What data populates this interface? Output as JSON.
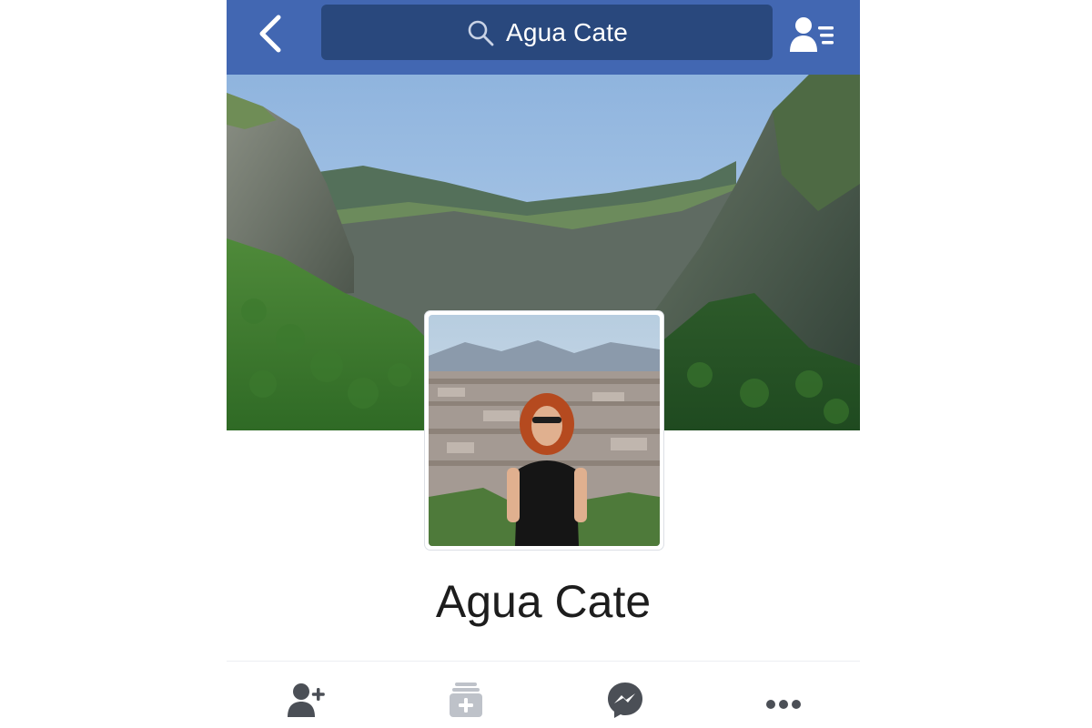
{
  "header": {
    "search_value": "Agua Cate",
    "icons": {
      "back": "chevron-left-icon",
      "search": "search-icon",
      "friends": "friends-list-icon"
    }
  },
  "profile": {
    "name": "Agua Cate"
  },
  "actions": {
    "icons": [
      "add-friend-icon",
      "follow-icon",
      "messenger-icon",
      "more-icon"
    ]
  },
  "colors": {
    "header_bg": "#4267b2",
    "search_bg": "#29487d",
    "action_icon": "#4b4f56",
    "name_text": "#1d1d1d"
  }
}
